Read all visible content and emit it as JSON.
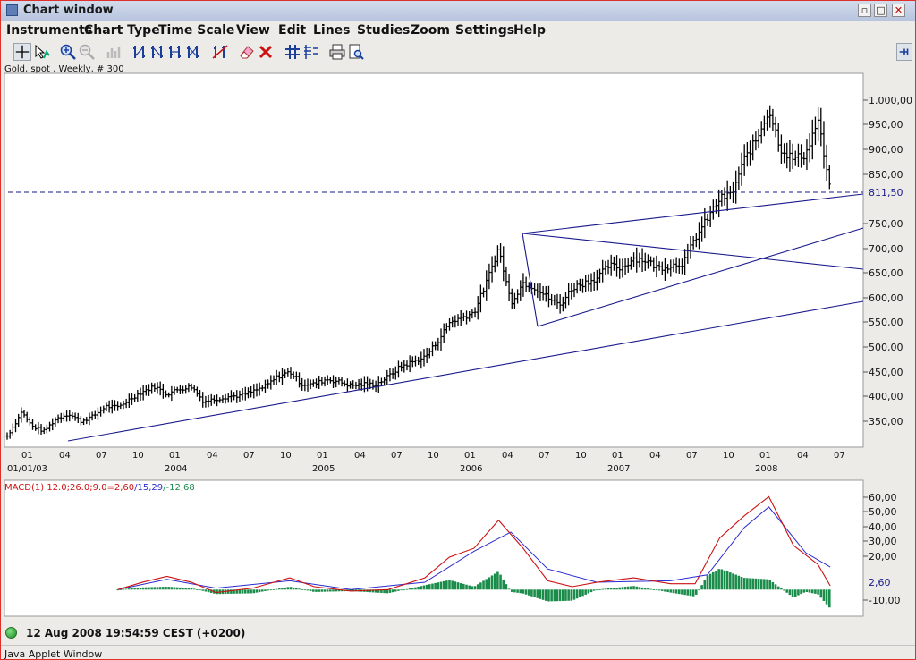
{
  "window": {
    "title": "Chart window"
  },
  "menu": [
    "Instruments",
    "Chart Type",
    "Time Scale",
    "View",
    "Edit",
    "Lines",
    "Studies",
    "Zoom",
    "Settings",
    "Help"
  ],
  "toolbar": {
    "icons": [
      "crosshair-icon",
      "cursor-chart-icon",
      "zoom-in-icon",
      "zoom-out-icon",
      "bar-chart-icon",
      "bar-type-1-icon",
      "bar-type-2-icon",
      "bar-type-3-icon",
      "bar-type-4-icon",
      "draw-line-icon",
      "eraser-icon",
      "delete-icon",
      "grid-icon",
      "table-icon",
      "print-icon",
      "print-preview-icon",
      "pin-icon"
    ]
  },
  "chart": {
    "instrument_label": "Gold, spot , Weekly, # 300",
    "price_labels": [
      "1.000,00",
      "950,00",
      "900,00",
      "850,00",
      "750,00",
      "700,00",
      "650,00",
      "600,00",
      "550,00",
      "500,00",
      "450,00",
      "400,00",
      "350,00"
    ],
    "last_price_label": "811,50",
    "month_ticks": [
      "01",
      "04",
      "07",
      "10",
      "01",
      "04",
      "07",
      "10",
      "01",
      "04",
      "07",
      "10",
      "01",
      "04",
      "07",
      "10",
      "01",
      "04",
      "07",
      "10",
      "01",
      "04",
      "07"
    ],
    "year_labels": [
      "01/01/03",
      "2004",
      "2005",
      "2006",
      "2007",
      "2008"
    ],
    "macd": {
      "title_main": "MACD(1) 12.0;26.0;9.0=2,60",
      "title_signal": "/15,29",
      "title_hist": "/-12,68",
      "axis_labels": [
        "60,00",
        "50,00",
        "40,00",
        "30,00",
        "20,00",
        "-10,00"
      ],
      "last_value_label": "2,60"
    },
    "colors": {
      "price": "#000000",
      "trend": "#1a1a8c",
      "macd": "#cc1111",
      "signal": "#2a2ad0",
      "hist": "#1a8c4a"
    }
  },
  "chart_data": [
    {
      "type": "bar",
      "title": "Gold, spot , Weekly, # 300",
      "x_range": [
        "2003-01",
        "2008-08"
      ],
      "ylim": [
        310,
        1040
      ],
      "series": [
        {
          "values": [
            {
              "x": "2003-01",
              "y": 320
            },
            {
              "x": "2003-02",
              "y": 360
            },
            {
              "x": "2003-02",
              "y": 375
            },
            {
              "x": "2003-03",
              "y": 340
            },
            {
              "x": "2003-04",
              "y": 330
            },
            {
              "x": "2003-05",
              "y": 355
            },
            {
              "x": "2003-06",
              "y": 365
            },
            {
              "x": "2003-07",
              "y": 350
            },
            {
              "x": "2003-08",
              "y": 360
            },
            {
              "x": "2003-09",
              "y": 380
            },
            {
              "x": "2003-10",
              "y": 378
            },
            {
              "x": "2003-11",
              "y": 395
            },
            {
              "x": "2003-12",
              "y": 410
            },
            {
              "x": "2004-01",
              "y": 420
            },
            {
              "x": "2004-02",
              "y": 405
            },
            {
              "x": "2004-03",
              "y": 415
            },
            {
              "x": "2004-04",
              "y": 420
            },
            {
              "x": "2004-05",
              "y": 390
            },
            {
              "x": "2004-06",
              "y": 395
            },
            {
              "x": "2004-07",
              "y": 400
            },
            {
              "x": "2004-08",
              "y": 402
            },
            {
              "x": "2004-09",
              "y": 410
            },
            {
              "x": "2004-10",
              "y": 420
            },
            {
              "x": "2004-11",
              "y": 440
            },
            {
              "x": "2004-12",
              "y": 450
            },
            {
              "x": "2005-01",
              "y": 425
            },
            {
              "x": "2005-02",
              "y": 425
            },
            {
              "x": "2005-03",
              "y": 435
            },
            {
              "x": "2005-04",
              "y": 430
            },
            {
              "x": "2005-05",
              "y": 422
            },
            {
              "x": "2005-06",
              "y": 425
            },
            {
              "x": "2005-07",
              "y": 424
            },
            {
              "x": "2005-08",
              "y": 440
            },
            {
              "x": "2005-09",
              "y": 460
            },
            {
              "x": "2005-10",
              "y": 470
            },
            {
              "x": "2005-11",
              "y": 480
            },
            {
              "x": "2005-12",
              "y": 510
            },
            {
              "x": "2006-01",
              "y": 550
            },
            {
              "x": "2006-02",
              "y": 560
            },
            {
              "x": "2006-03",
              "y": 570
            },
            {
              "x": "2006-04",
              "y": 630
            },
            {
              "x": "2006-05",
              "y": 700
            },
            {
              "x": "2006-06",
              "y": 590
            },
            {
              "x": "2006-07",
              "y": 630
            },
            {
              "x": "2006-08",
              "y": 620
            },
            {
              "x": "2006-09",
              "y": 600
            },
            {
              "x": "2006-10",
              "y": 585
            },
            {
              "x": "2006-11",
              "y": 620
            },
            {
              "x": "2006-12",
              "y": 630
            },
            {
              "x": "2007-01",
              "y": 640
            },
            {
              "x": "2007-02",
              "y": 665
            },
            {
              "x": "2007-03",
              "y": 660
            },
            {
              "x": "2007-04",
              "y": 680
            },
            {
              "x": "2007-05",
              "y": 675
            },
            {
              "x": "2007-06",
              "y": 660
            },
            {
              "x": "2007-07",
              "y": 665
            },
            {
              "x": "2007-08",
              "y": 670
            },
            {
              "x": "2007-09",
              "y": 720
            },
            {
              "x": "2007-10",
              "y": 760
            },
            {
              "x": "2007-11",
              "y": 800
            },
            {
              "x": "2007-12",
              "y": 810
            },
            {
              "x": "2008-01",
              "y": 880
            },
            {
              "x": "2008-02",
              "y": 920
            },
            {
              "x": "2008-03",
              "y": 980
            },
            {
              "x": "2008-04",
              "y": 900
            },
            {
              "x": "2008-05",
              "y": 880
            },
            {
              "x": "2008-06",
              "y": 890
            },
            {
              "x": "2008-07",
              "y": 960
            },
            {
              "x": "2008-08",
              "y": 811.5
            }
          ]
        }
      ]
    },
    {
      "type": "line",
      "title": "MACD(1) 12.0;26.0;9.0=2,60/15,29/-12,68",
      "x_range": [
        "2003-01",
        "2008-08"
      ],
      "ylim": [
        -15,
        65
      ],
      "series": [
        {
          "values": [
            {
              "x": "2003-10",
              "y": 0
            },
            {
              "x": "2003-12",
              "y": 5
            },
            {
              "x": "2004-02",
              "y": 9
            },
            {
              "x": "2004-04",
              "y": 5
            },
            {
              "x": "2004-06",
              "y": -2
            },
            {
              "x": "2004-09",
              "y": 1
            },
            {
              "x": "2004-12",
              "y": 8
            },
            {
              "x": "2005-02",
              "y": 2
            },
            {
              "x": "2005-05",
              "y": -1
            },
            {
              "x": "2005-08",
              "y": 0
            },
            {
              "x": "2005-11",
              "y": 8
            },
            {
              "x": "2006-01",
              "y": 22
            },
            {
              "x": "2006-03",
              "y": 28
            },
            {
              "x": "2006-05",
              "y": 47
            },
            {
              "x": "2006-07",
              "y": 28
            },
            {
              "x": "2006-09",
              "y": 6
            },
            {
              "x": "2006-11",
              "y": 2
            },
            {
              "x": "2007-01",
              "y": 5
            },
            {
              "x": "2007-04",
              "y": 8
            },
            {
              "x": "2007-07",
              "y": 4
            },
            {
              "x": "2007-09",
              "y": 4
            },
            {
              "x": "2007-11",
              "y": 35
            },
            {
              "x": "2008-01",
              "y": 50
            },
            {
              "x": "2008-03",
              "y": 63
            },
            {
              "x": "2008-05",
              "y": 30
            },
            {
              "x": "2008-07",
              "y": 17
            },
            {
              "x": "2008-08",
              "y": 2.6
            }
          ]
        },
        {
          "values": [
            {
              "x": "2003-10",
              "y": 0
            },
            {
              "x": "2004-02",
              "y": 7
            },
            {
              "x": "2004-06",
              "y": 1
            },
            {
              "x": "2004-12",
              "y": 6
            },
            {
              "x": "2005-05",
              "y": 0
            },
            {
              "x": "2005-11",
              "y": 5
            },
            {
              "x": "2006-03",
              "y": 26
            },
            {
              "x": "2006-06",
              "y": 39
            },
            {
              "x": "2006-09",
              "y": 14
            },
            {
              "x": "2007-01",
              "y": 5
            },
            {
              "x": "2007-07",
              "y": 6
            },
            {
              "x": "2007-10",
              "y": 10
            },
            {
              "x": "2008-01",
              "y": 42
            },
            {
              "x": "2008-03",
              "y": 56
            },
            {
              "x": "2008-06",
              "y": 25
            },
            {
              "x": "2008-08",
              "y": 15.29
            }
          ]
        }
      ]
    }
  ]
}
